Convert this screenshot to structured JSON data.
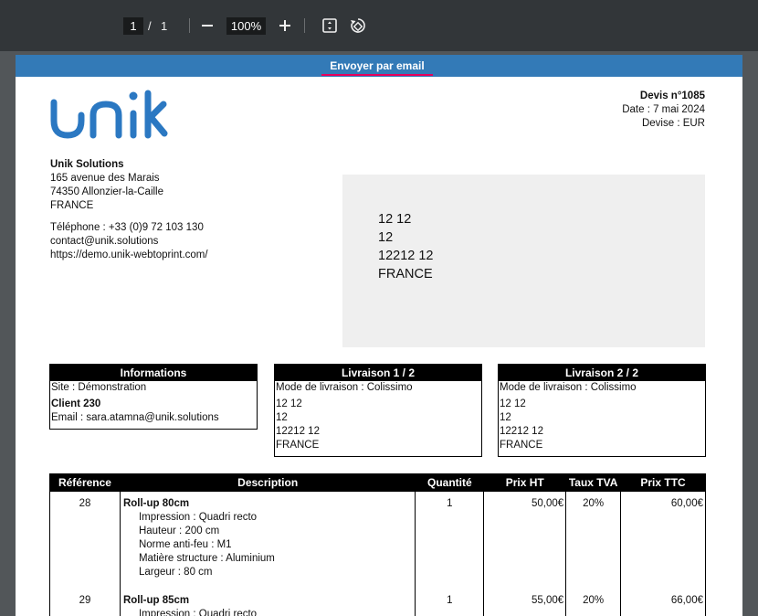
{
  "toolbar": {
    "page_current": "1",
    "page_separator": "/",
    "page_total": "1",
    "zoom": "100%"
  },
  "email_bar": {
    "label": "Envoyer par email"
  },
  "logo": {
    "text": "unik",
    "color": "#2b78c2"
  },
  "devis": {
    "number": "Devis n°1085",
    "date": "Date : 7 mai 2024",
    "currency": "Devise : EUR"
  },
  "company": {
    "name": "Unik Solutions",
    "street": "165 avenue des Marais",
    "city": "74350 Allonzier-la-Caille",
    "country": "FRANCE",
    "phone": "Téléphone : +33 (0)9 72 103 130",
    "email": "contact@unik.solutions",
    "website": "https://demo.unik-webtoprint.com/"
  },
  "recipient": {
    "lines": [
      "12 12",
      "12",
      "12212 12",
      "FRANCE"
    ]
  },
  "informations": {
    "title": "Informations",
    "site": "Site : Démonstration",
    "client": "Client 230",
    "email": "Email : sara.atamna@unik.solutions"
  },
  "livraison1": {
    "title": "Livraison 1 / 2",
    "mode": "Mode de livraison : Colissimo",
    "lines": [
      "12 12",
      "12",
      "12212 12",
      "FRANCE"
    ]
  },
  "livraison2": {
    "title": "Livraison 2 / 2",
    "mode": "Mode de livraison : Colissimo",
    "lines": [
      "12 12",
      "12",
      "12212 12",
      "FRANCE"
    ]
  },
  "items_table": {
    "headers": [
      "Référence",
      "Description",
      "Quantité",
      "Prix HT",
      "Taux TVA",
      "Prix TTC"
    ],
    "rows": [
      {
        "ref": "28",
        "name": "Roll-up 80cm",
        "options": [
          "Impression : Quadri recto",
          "Hauteur : 200 cm",
          "Norme anti-feu : M1",
          "Matière structure : Aluminium",
          "Largeur : 80 cm"
        ],
        "qty": "1",
        "price_ht": "50,00€",
        "tva": "20%",
        "price_ttc": "60,00€"
      },
      {
        "ref": "29",
        "name": "Roll-up 85cm",
        "options": [
          "Impression : Quadri recto"
        ],
        "qty": "1",
        "price_ht": "55,00€",
        "tva": "20%",
        "price_ttc": "66,00€"
      }
    ]
  }
}
